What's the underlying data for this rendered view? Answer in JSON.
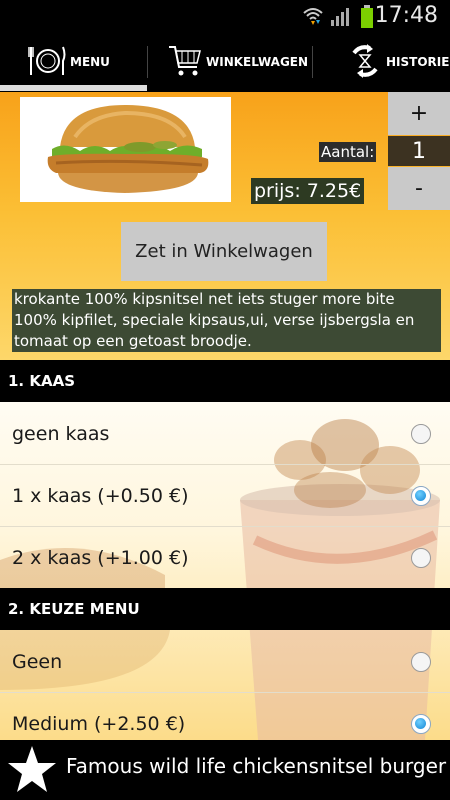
{
  "status_bar": {
    "time": "17:48"
  },
  "nav": {
    "tabs": [
      {
        "label": "MENU",
        "icon": "plate-cutlery-icon",
        "active": true
      },
      {
        "label": "WINKELWAGEN",
        "icon": "shopping-cart-icon",
        "active": false
      },
      {
        "label": "HISTORIE",
        "icon": "history-icon",
        "active": false
      }
    ]
  },
  "product": {
    "quantity_label": "Aantal:",
    "quantity": "1",
    "plus_label": "+",
    "minus_label": "-",
    "price_text": "prijs: 7.25€",
    "add_to_cart_label": "Zet in Winkelwagen",
    "description": "krokante 100% kipsnitsel net iets stuger more bite 100% kipfilet, speciale kipsaus,ui, verse ijsbergsla en tomaat op een getoast broodje."
  },
  "sections": [
    {
      "title": "1. KAAS",
      "options": [
        {
          "label": "geen kaas",
          "selected": false
        },
        {
          "label": "1 x kaas (+0.50 €)",
          "selected": true
        },
        {
          "label": "2 x kaas (+1.00 €)",
          "selected": false
        }
      ]
    },
    {
      "title": "2. KEUZE MENU",
      "options": [
        {
          "label": "Geen",
          "selected": false
        },
        {
          "label": "Medium (+2.50 €)",
          "selected": true
        }
      ]
    }
  ],
  "footer": {
    "title": "Famous wild life chickensnitsel burger",
    "icon": "star-icon"
  },
  "colors": {
    "accent_orange": "#f8a21a",
    "radio_selected": "#1486d4",
    "bar_black": "#000000"
  }
}
